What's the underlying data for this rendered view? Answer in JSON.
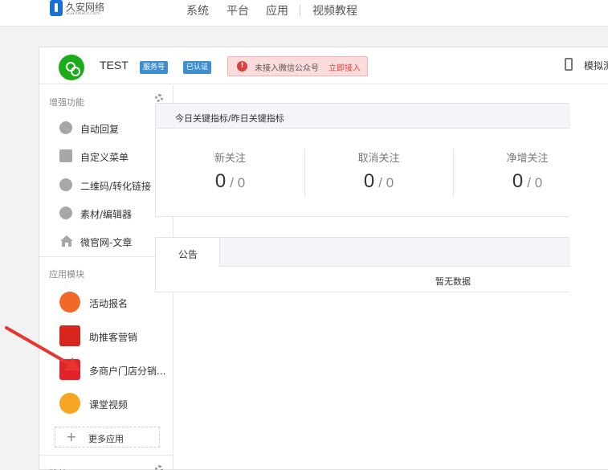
{
  "logo": {
    "text": "久安网络",
    "sub": "suanwatv.com"
  },
  "nav": {
    "items": [
      "系统",
      "平台",
      "应用",
      "视频教程"
    ]
  },
  "account": {
    "name": "TEST",
    "badges": [
      "服务号",
      "已认证"
    ],
    "alert_text": "未接入微信公众号",
    "alert_link": "立即接入",
    "simulator": "模拟测"
  },
  "sidebar": {
    "enhance_title": "增强功能",
    "enhance_items": [
      "自动回复",
      "自定义菜单",
      "二维码/转化链接",
      "素材/编辑器",
      "微官网-文章"
    ],
    "apps_title": "应用模块",
    "app_items": [
      "活动报名",
      "助推客营销",
      "多商户门店分销...",
      "课堂视频"
    ],
    "more_label": "更多应用",
    "next_title": "粉丝"
  },
  "kpis": {
    "title": "今日关键指标/昨日关键指标",
    "items": [
      {
        "label": "新关注",
        "today": "0",
        "yesterday": "/ 0"
      },
      {
        "label": "取消关注",
        "today": "0",
        "yesterday": "/ 0"
      },
      {
        "label": "净增关注",
        "today": "0",
        "yesterday": "/ 0"
      }
    ]
  },
  "notice": {
    "tab": "公告",
    "empty": "暂无数据"
  },
  "colors": {
    "accent": "#3e8ed0",
    "alert": "#e0433f",
    "wechat_green": "#1aad19",
    "arrow": "#e8352f"
  }
}
